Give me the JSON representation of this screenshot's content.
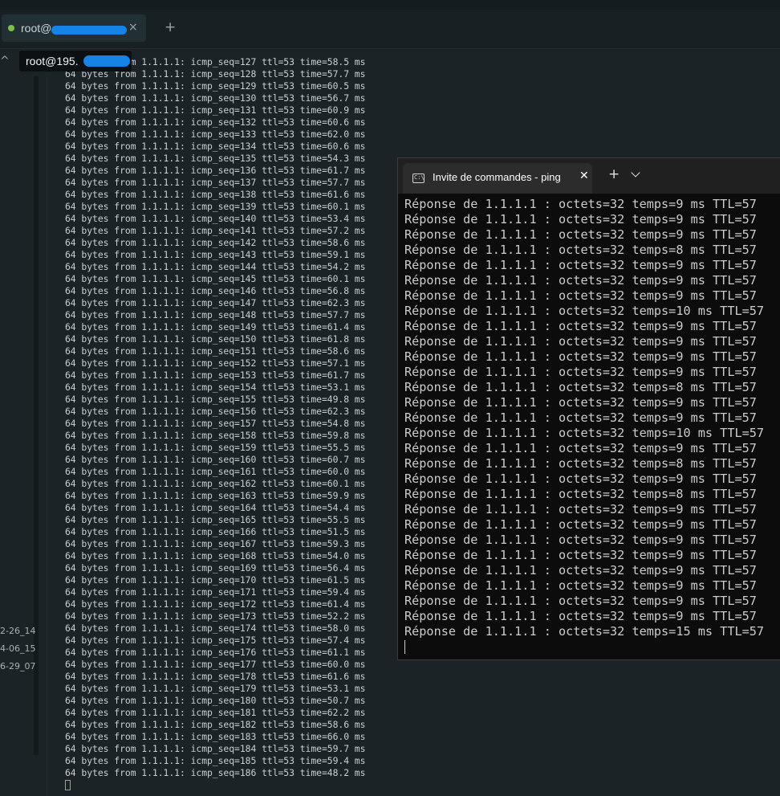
{
  "linux_tab": {
    "label": "root@",
    "close_glyph": "×",
    "new_tab_glyph": "+"
  },
  "tooltip": {
    "label": "root@195."
  },
  "sidebar": {
    "labels": [
      "2-26_14",
      "4-06_15",
      "6-29_07"
    ]
  },
  "linux_terminal": {
    "lines": [
      "64 bytes from 1.1.1.1: icmp_seq=127 ttl=53 time=58.5 ms",
      "64 bytes from 1.1.1.1: icmp_seq=128 ttl=53 time=57.7 ms",
      "64 bytes from 1.1.1.1: icmp_seq=129 ttl=53 time=60.5 ms",
      "64 bytes from 1.1.1.1: icmp_seq=130 ttl=53 time=56.7 ms",
      "64 bytes from 1.1.1.1: icmp_seq=131 ttl=53 time=60.9 ms",
      "64 bytes from 1.1.1.1: icmp_seq=132 ttl=53 time=60.6 ms",
      "64 bytes from 1.1.1.1: icmp_seq=133 ttl=53 time=62.0 ms",
      "64 bytes from 1.1.1.1: icmp_seq=134 ttl=53 time=60.6 ms",
      "64 bytes from 1.1.1.1: icmp_seq=135 ttl=53 time=54.3 ms",
      "64 bytes from 1.1.1.1: icmp_seq=136 ttl=53 time=61.7 ms",
      "64 bytes from 1.1.1.1: icmp_seq=137 ttl=53 time=57.7 ms",
      "64 bytes from 1.1.1.1: icmp_seq=138 ttl=53 time=61.6 ms",
      "64 bytes from 1.1.1.1: icmp_seq=139 ttl=53 time=60.1 ms",
      "64 bytes from 1.1.1.1: icmp_seq=140 ttl=53 time=53.4 ms",
      "64 bytes from 1.1.1.1: icmp_seq=141 ttl=53 time=57.2 ms",
      "64 bytes from 1.1.1.1: icmp_seq=142 ttl=53 time=58.6 ms",
      "64 bytes from 1.1.1.1: icmp_seq=143 ttl=53 time=59.1 ms",
      "64 bytes from 1.1.1.1: icmp_seq=144 ttl=53 time=54.2 ms",
      "64 bytes from 1.1.1.1: icmp_seq=145 ttl=53 time=60.1 ms",
      "64 bytes from 1.1.1.1: icmp_seq=146 ttl=53 time=56.8 ms",
      "64 bytes from 1.1.1.1: icmp_seq=147 ttl=53 time=62.3 ms",
      "64 bytes from 1.1.1.1: icmp_seq=148 ttl=53 time=57.7 ms",
      "64 bytes from 1.1.1.1: icmp_seq=149 ttl=53 time=61.4 ms",
      "64 bytes from 1.1.1.1: icmp_seq=150 ttl=53 time=61.8 ms",
      "64 bytes from 1.1.1.1: icmp_seq=151 ttl=53 time=58.6 ms",
      "64 bytes from 1.1.1.1: icmp_seq=152 ttl=53 time=57.1 ms",
      "64 bytes from 1.1.1.1: icmp_seq=153 ttl=53 time=61.7 ms",
      "64 bytes from 1.1.1.1: icmp_seq=154 ttl=53 time=53.1 ms",
      "64 bytes from 1.1.1.1: icmp_seq=155 ttl=53 time=49.8 ms",
      "64 bytes from 1.1.1.1: icmp_seq=156 ttl=53 time=62.3 ms",
      "64 bytes from 1.1.1.1: icmp_seq=157 ttl=53 time=54.8 ms",
      "64 bytes from 1.1.1.1: icmp_seq=158 ttl=53 time=59.8 ms",
      "64 bytes from 1.1.1.1: icmp_seq=159 ttl=53 time=55.5 ms",
      "64 bytes from 1.1.1.1: icmp_seq=160 ttl=53 time=60.7 ms",
      "64 bytes from 1.1.1.1: icmp_seq=161 ttl=53 time=60.0 ms",
      "64 bytes from 1.1.1.1: icmp_seq=162 ttl=53 time=60.1 ms",
      "64 bytes from 1.1.1.1: icmp_seq=163 ttl=53 time=59.9 ms",
      "64 bytes from 1.1.1.1: icmp_seq=164 ttl=53 time=54.4 ms",
      "64 bytes from 1.1.1.1: icmp_seq=165 ttl=53 time=55.5 ms",
      "64 bytes from 1.1.1.1: icmp_seq=166 ttl=53 time=51.5 ms",
      "64 bytes from 1.1.1.1: icmp_seq=167 ttl=53 time=59.3 ms",
      "64 bytes from 1.1.1.1: icmp_seq=168 ttl=53 time=54.0 ms",
      "64 bytes from 1.1.1.1: icmp_seq=169 ttl=53 time=56.4 ms",
      "64 bytes from 1.1.1.1: icmp_seq=170 ttl=53 time=61.5 ms",
      "64 bytes from 1.1.1.1: icmp_seq=171 ttl=53 time=59.4 ms",
      "64 bytes from 1.1.1.1: icmp_seq=172 ttl=53 time=61.4 ms",
      "64 bytes from 1.1.1.1: icmp_seq=173 ttl=53 time=52.2 ms",
      "64 bytes from 1.1.1.1: icmp_seq=174 ttl=53 time=58.0 ms",
      "64 bytes from 1.1.1.1: icmp_seq=175 ttl=53 time=57.4 ms",
      "64 bytes from 1.1.1.1: icmp_seq=176 ttl=53 time=61.1 ms",
      "64 bytes from 1.1.1.1: icmp_seq=177 ttl=53 time=60.0 ms",
      "64 bytes from 1.1.1.1: icmp_seq=178 ttl=53 time=61.6 ms",
      "64 bytes from 1.1.1.1: icmp_seq=179 ttl=53 time=53.1 ms",
      "64 bytes from 1.1.1.1: icmp_seq=180 ttl=53 time=50.7 ms",
      "64 bytes from 1.1.1.1: icmp_seq=181 ttl=53 time=62.2 ms",
      "64 bytes from 1.1.1.1: icmp_seq=182 ttl=53 time=58.6 ms",
      "64 bytes from 1.1.1.1: icmp_seq=183 ttl=53 time=66.0 ms",
      "64 bytes from 1.1.1.1: icmp_seq=184 ttl=53 time=59.7 ms",
      "64 bytes from 1.1.1.1: icmp_seq=185 ttl=53 time=59.4 ms",
      "64 bytes from 1.1.1.1: icmp_seq=186 ttl=53 time=48.2 ms"
    ]
  },
  "windows_terminal": {
    "tab_title": "Invite de commandes - ping",
    "close_glyph": "✕",
    "new_tab_glyph": "+",
    "lines": [
      "Réponse de 1.1.1.1 : octets=32 temps=9 ms TTL=57",
      "Réponse de 1.1.1.1 : octets=32 temps=9 ms TTL=57",
      "Réponse de 1.1.1.1 : octets=32 temps=9 ms TTL=57",
      "Réponse de 1.1.1.1 : octets=32 temps=8 ms TTL=57",
      "Réponse de 1.1.1.1 : octets=32 temps=9 ms TTL=57",
      "Réponse de 1.1.1.1 : octets=32 temps=9 ms TTL=57",
      "Réponse de 1.1.1.1 : octets=32 temps=9 ms TTL=57",
      "Réponse de 1.1.1.1 : octets=32 temps=10 ms TTL=57",
      "Réponse de 1.1.1.1 : octets=32 temps=9 ms TTL=57",
      "Réponse de 1.1.1.1 : octets=32 temps=9 ms TTL=57",
      "Réponse de 1.1.1.1 : octets=32 temps=9 ms TTL=57",
      "Réponse de 1.1.1.1 : octets=32 temps=9 ms TTL=57",
      "Réponse de 1.1.1.1 : octets=32 temps=8 ms TTL=57",
      "Réponse de 1.1.1.1 : octets=32 temps=9 ms TTL=57",
      "Réponse de 1.1.1.1 : octets=32 temps=9 ms TTL=57",
      "Réponse de 1.1.1.1 : octets=32 temps=10 ms TTL=57",
      "Réponse de 1.1.1.1 : octets=32 temps=9 ms TTL=57",
      "Réponse de 1.1.1.1 : octets=32 temps=8 ms TTL=57",
      "Réponse de 1.1.1.1 : octets=32 temps=9 ms TTL=57",
      "Réponse de 1.1.1.1 : octets=32 temps=8 ms TTL=57",
      "Réponse de 1.1.1.1 : octets=32 temps=9 ms TTL=57",
      "Réponse de 1.1.1.1 : octets=32 temps=9 ms TTL=57",
      "Réponse de 1.1.1.1 : octets=32 temps=9 ms TTL=57",
      "Réponse de 1.1.1.1 : octets=32 temps=9 ms TTL=57",
      "Réponse de 1.1.1.1 : octets=32 temps=9 ms TTL=57",
      "Réponse de 1.1.1.1 : octets=32 temps=9 ms TTL=57",
      "Réponse de 1.1.1.1 : octets=32 temps=9 ms TTL=57",
      "Réponse de 1.1.1.1 : octets=32 temps=9 ms TTL=57",
      "Réponse de 1.1.1.1 : octets=32 temps=15 ms TTL=57"
    ]
  },
  "colors": {
    "redaction": "#1584e6",
    "status_dot": "#7fbf4d",
    "cursor": "#5ed045"
  }
}
